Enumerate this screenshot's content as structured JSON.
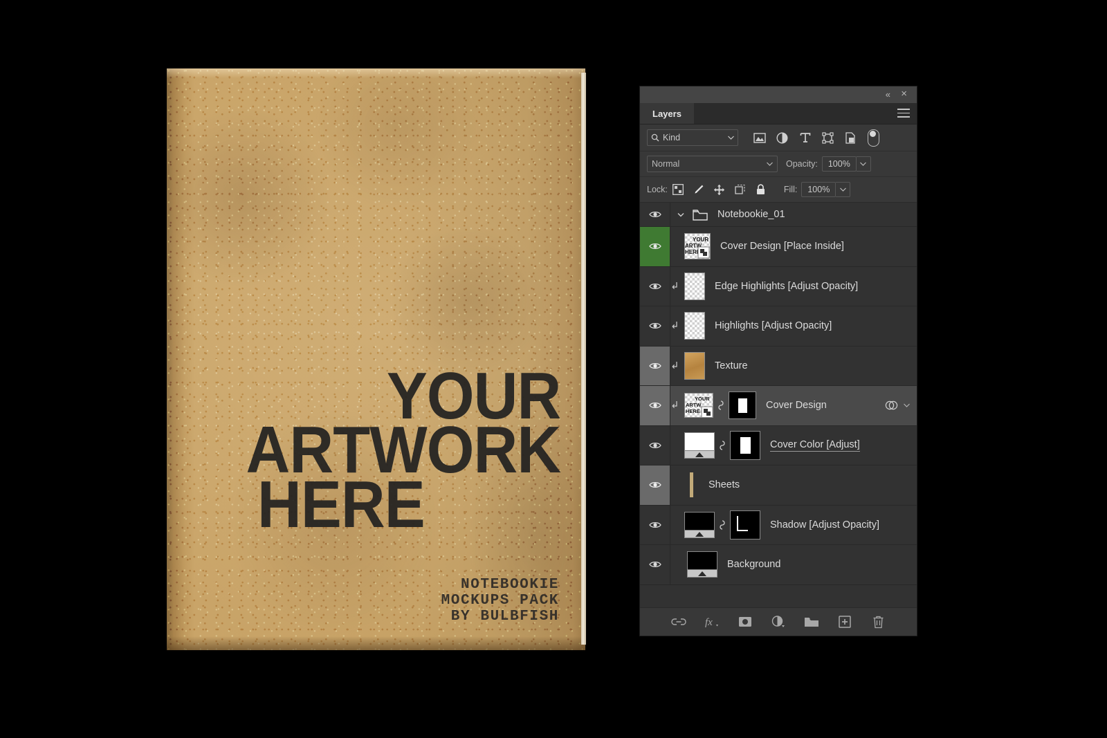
{
  "mockup": {
    "artwork_lines": [
      "YOUR",
      "ARTWORK",
      "HERE"
    ],
    "caption_lines": [
      "NOTEBOOKIE",
      "MOCKUPS PACK",
      "BY BULBFISH"
    ],
    "cover_color": "#c6a165",
    "ink_color": "#232221",
    "background_color": "#000000"
  },
  "panel": {
    "title": "Layers",
    "collapse_icon": "«",
    "close_icon": "×",
    "menu_icon": "hamburger-icon",
    "filter": {
      "search_icon": "search-icon",
      "kind_label": "Kind",
      "chevron": "⌄",
      "icons": [
        "pixel-filter-icon",
        "adjustment-filter-icon",
        "type-filter-icon",
        "shape-filter-icon",
        "smart-object-filter-icon"
      ],
      "toggle": "filter-enable-toggle"
    },
    "blend": {
      "mode": "Normal",
      "chevron": "⌄",
      "opacity_label": "Opacity:",
      "opacity_value": "100%"
    },
    "lock": {
      "label": "Lock:",
      "icons": [
        "lock-transparent-pixels-icon",
        "lock-image-pixels-icon",
        "lock-position-icon",
        "lock-artboard-nesting-icon",
        "lock-all-icon"
      ],
      "fill_label": "Fill:",
      "fill_value": "100%"
    },
    "layers": [
      {
        "name": "Notebookie_01",
        "type": "group",
        "visible": true,
        "expanded": true,
        "eye_state": "normal",
        "selected": false,
        "clipped": false
      },
      {
        "name": "Cover Design [Place Inside]",
        "type": "smart-object",
        "visible": true,
        "eye_state": "highlight-green",
        "selected": false,
        "clipped": false,
        "thumb": "artwork-thumb"
      },
      {
        "name": "Edge Highlights [Adjust Opacity]",
        "type": "pixel",
        "visible": true,
        "eye_state": "normal",
        "selected": false,
        "clipped": true,
        "thumb": "transparent-thumb"
      },
      {
        "name": "Highlights [Adjust Opacity]",
        "type": "pixel",
        "visible": true,
        "eye_state": "normal",
        "selected": false,
        "clipped": true,
        "thumb": "transparent-thumb"
      },
      {
        "name": "Texture",
        "type": "pixel",
        "visible": true,
        "eye_state": "dim",
        "selected": false,
        "clipped": true,
        "thumb": "kraft-texture-thumb"
      },
      {
        "name": "Cover Design",
        "type": "smart-object",
        "visible": true,
        "eye_state": "dim",
        "selected": true,
        "clipped": true,
        "thumb": "artwork-thumb",
        "has_mask": true,
        "has_link": true,
        "has_effects": true,
        "effects_icon": "layer-effects-icon",
        "effects_chevron": "⌄"
      },
      {
        "name": "Cover Color [Adjust]",
        "type": "adjustment",
        "visible": true,
        "eye_state": "normal",
        "selected": false,
        "clipped": false,
        "thumb": "adjustment-thumb",
        "has_mask": true,
        "has_link": true,
        "editing": true
      },
      {
        "name": "Sheets",
        "type": "group-bar",
        "visible": true,
        "eye_state": "dim",
        "selected": false,
        "clipped": false,
        "thumb": "sheets-bar"
      },
      {
        "name": "Shadow [Adjust Opacity]",
        "type": "pixel",
        "visible": true,
        "eye_state": "normal",
        "selected": false,
        "clipped": false,
        "thumb": "black-doc-thumb",
        "has_mask": true,
        "has_link": true
      },
      {
        "name": "Background",
        "type": "pixel",
        "visible": true,
        "eye_state": "normal",
        "selected": false,
        "clipped": false,
        "thumb": "black-doc-thumb"
      }
    ],
    "bottom_icons": [
      "link-layers-icon",
      "layer-style-fx-icon",
      "add-layer-mask-icon",
      "new-adjustment-layer-icon",
      "new-group-icon",
      "new-layer-icon",
      "delete-layer-icon"
    ]
  }
}
